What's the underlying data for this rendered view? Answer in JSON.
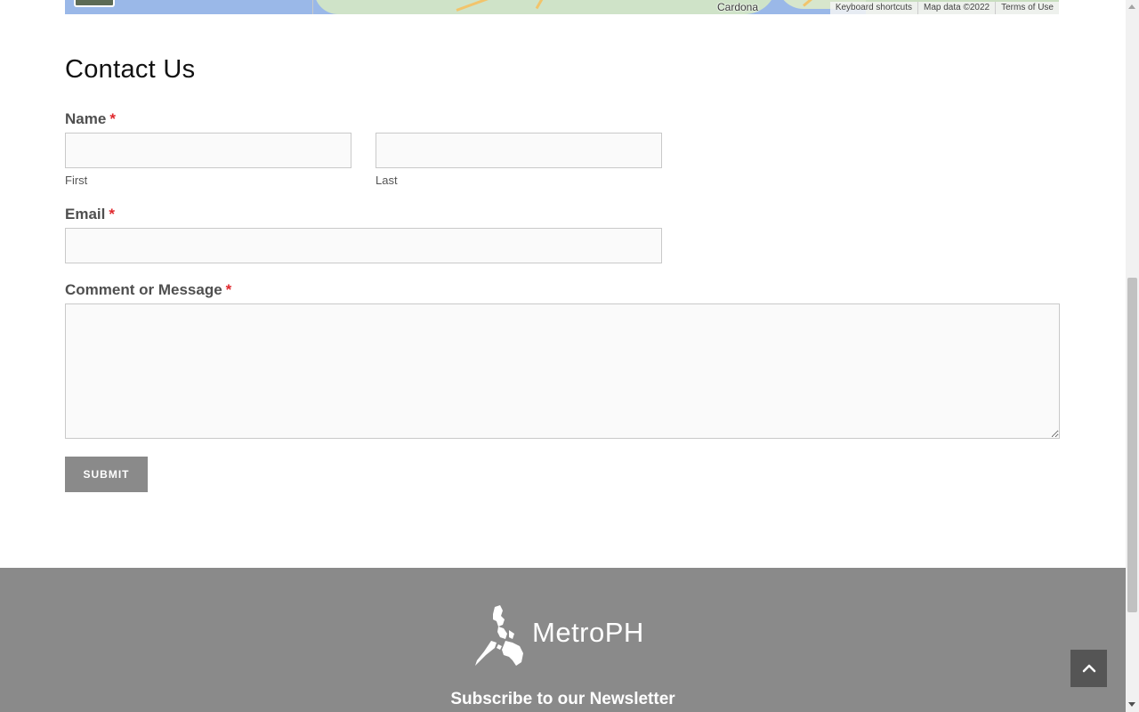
{
  "map": {
    "place_label": "Cardona",
    "attribution": {
      "shortcuts": "Keyboard shortcuts",
      "map_data": "Map data ©2022",
      "terms": "Terms of Use"
    }
  },
  "contact": {
    "title": "Contact Us",
    "required_mark": "*",
    "name": {
      "label": "Name",
      "first_sublabel": "First",
      "last_sublabel": "Last",
      "first_value": "",
      "last_value": ""
    },
    "email": {
      "label": "Email",
      "value": ""
    },
    "message": {
      "label": "Comment or Message",
      "value": ""
    },
    "submit_label": "SUBMIT"
  },
  "footer": {
    "brand": "MetroPH",
    "newsletter_heading": "Subscribe to our Newsletter"
  },
  "icons": {
    "back_to_top": "chevron-up-icon",
    "logo": "philippines-map-icon"
  },
  "colors": {
    "required": "#e0282d",
    "footer_bg": "#8a8a8a",
    "button_bg": "#8a8a8a",
    "to_top_bg": "#555555"
  }
}
